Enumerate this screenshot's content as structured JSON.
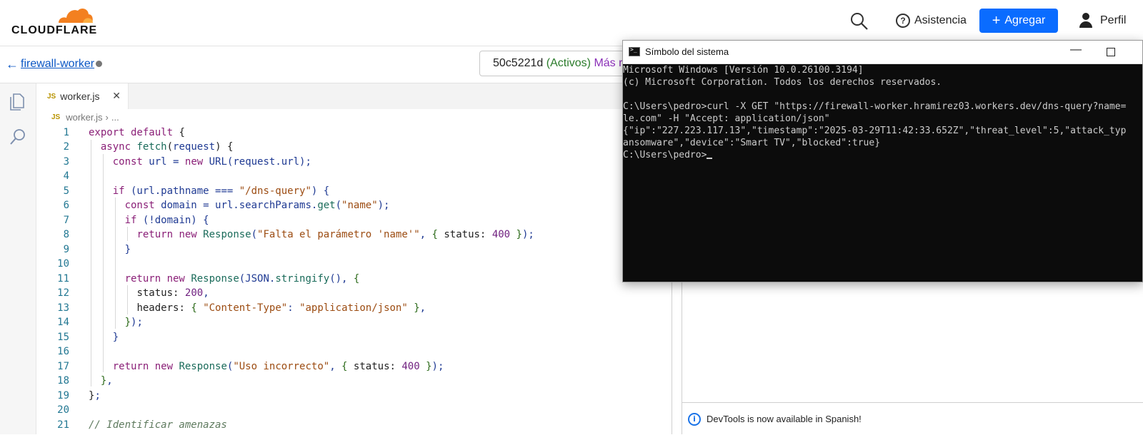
{
  "header": {
    "logo_text": "CLOUDFLARE",
    "help_label": "Asistencia",
    "add_label": "Agregar",
    "profile_label": "Perfil",
    "brand_color": "#f38020",
    "accent_color": "#0a6cff"
  },
  "worker": {
    "back_icon": "arrow-left-icon",
    "name": "firewall-worker",
    "version_id": "50c5221d",
    "version_status": "(Activos)",
    "version_more": "Más rec"
  },
  "editor": {
    "tab_badge": "JS",
    "tab_name": "worker.js",
    "breadcrumb_file": "worker.js",
    "breadcrumb_more": "...",
    "line_numbers": [
      "1",
      "2",
      "3",
      "4",
      "5",
      "6",
      "7",
      "8",
      "9",
      "10",
      "11",
      "12",
      "13",
      "14",
      "15",
      "16",
      "17",
      "18",
      "19",
      "20",
      "21"
    ]
  },
  "terminal": {
    "title": "Símbolo del sistema",
    "lines": [
      "Microsoft Windows [Versión 10.0.26100.3194]",
      "(c) Microsoft Corporation. Todos los derechos reservados.",
      "",
      "C:\\Users\\pedro>curl -X GET \"https://firewall-worker.hramirez03.workers.dev/dns-query?name=",
      "le.com\" -H \"Accept: application/json\"",
      "{\"ip\":\"227.223.117.13\",\"timestamp\":\"2025-03-29T11:42:33.652Z\",\"threat_level\":5,\"attack_typ",
      "ansomware\",\"device\":\"Smart TV\",\"blocked\":true}",
      "C:\\Users\\pedro>"
    ]
  },
  "devtools": {
    "message": "DevTools is now available in Spanish!"
  }
}
